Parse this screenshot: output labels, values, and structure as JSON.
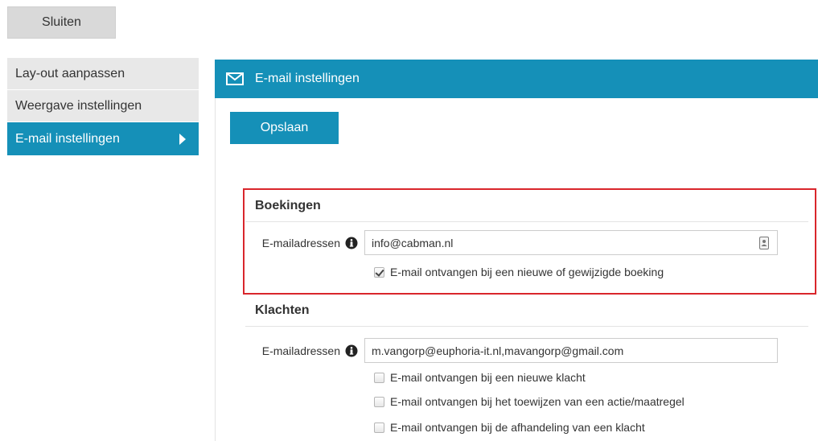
{
  "toolbar": {
    "close_label": "Sluiten"
  },
  "sidebar": {
    "items": [
      {
        "label": "Lay-out aanpassen"
      },
      {
        "label": "Weergave instellingen"
      },
      {
        "label": "E-mail instellingen"
      }
    ],
    "active_index": 2
  },
  "main": {
    "title": "E-mail instellingen",
    "save_label": "Opslaan",
    "sections": [
      {
        "title": "Boekingen",
        "email_label": "E-mailadressen",
        "email_value": "info@cabman.nl",
        "checkboxes": [
          {
            "label": "E-mail ontvangen bij een nieuwe of gewijzigde boeking",
            "checked": true
          }
        ]
      },
      {
        "title": "Klachten",
        "email_label": "E-mailadressen",
        "email_value": "m.vangorp@euphoria-it.nl,mavangorp@gmail.com",
        "checkboxes": [
          {
            "label": "E-mail ontvangen bij een nieuwe klacht",
            "checked": false
          },
          {
            "label": "E-mail ontvangen bij het toewijzen van een actie/maatregel",
            "checked": false
          },
          {
            "label": "E-mail ontvangen bij de afhandeling van een klacht",
            "checked": false
          }
        ]
      }
    ]
  },
  "colors": {
    "accent": "#1590b8",
    "highlight": "#d9262c",
    "sidebar_bg": "#e8e8e8"
  },
  "icons": {
    "header": "mail-icon",
    "info": "info-icon",
    "contacts": "address-book-icon",
    "active_marker": "arrow-right-icon"
  }
}
